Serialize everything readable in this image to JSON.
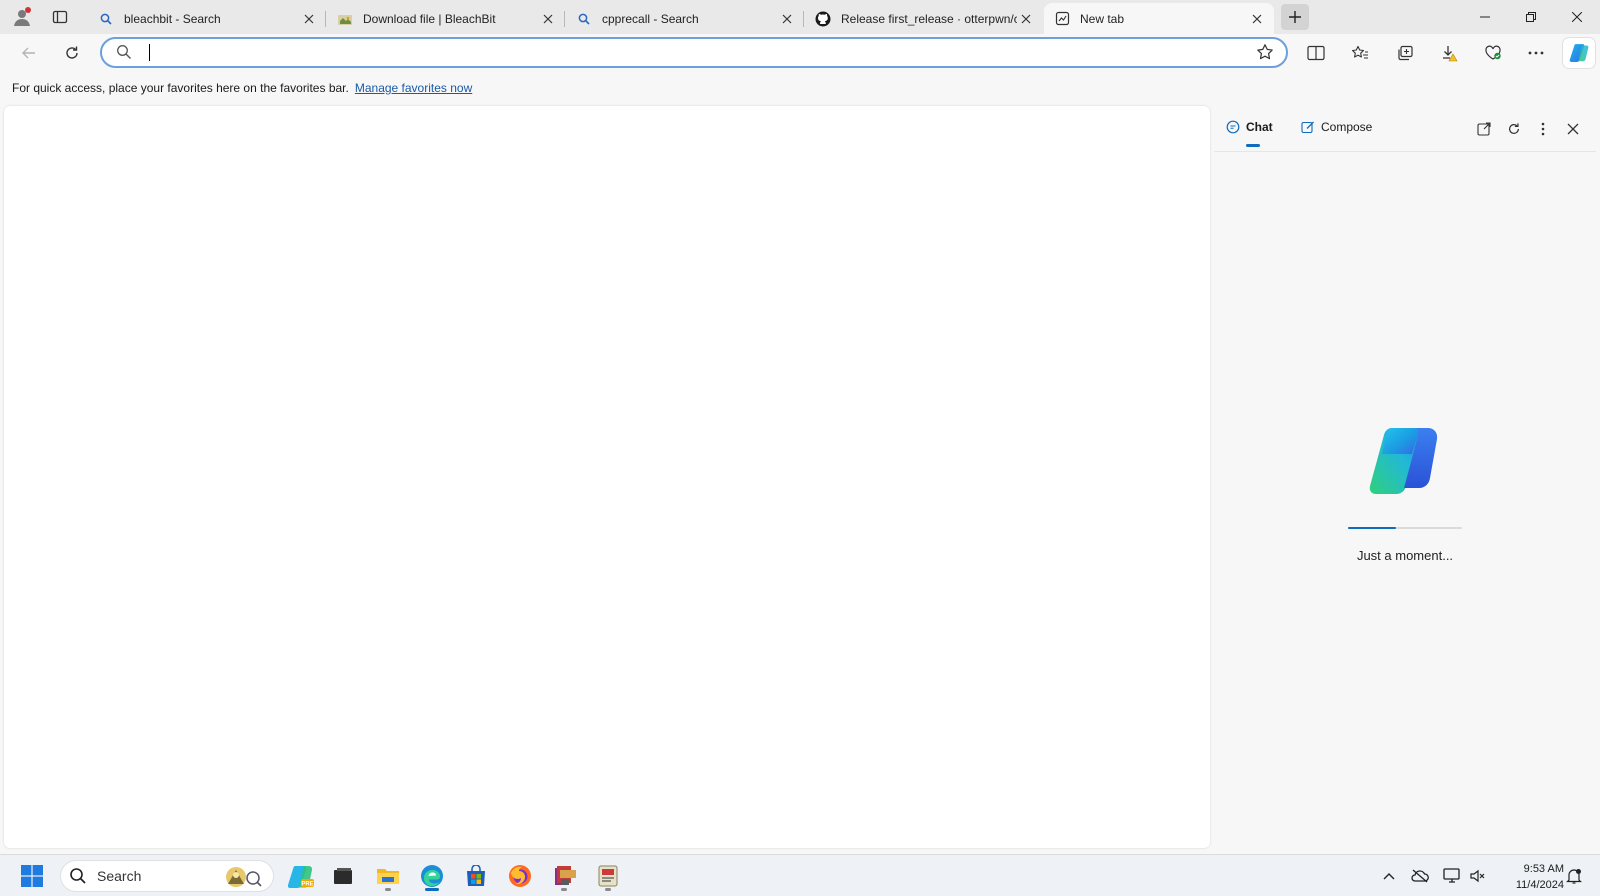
{
  "tabs": [
    {
      "title": "bleachbit - Search",
      "icon": "search-icon"
    },
    {
      "title": "Download file | BleachBit",
      "icon": "bleachbit-favicon"
    },
    {
      "title": "cpprecall - Search",
      "icon": "search-icon"
    },
    {
      "title": "Release first_release · otterpwn/cp",
      "icon": "github-icon"
    },
    {
      "title": "New tab",
      "icon": "new-tab-icon",
      "active": true
    }
  ],
  "address_bar": {
    "value": "",
    "placeholder": ""
  },
  "favorites_bar": {
    "message": "For quick access, place your favorites here on the favorites bar.",
    "link": "Manage favorites now"
  },
  "sidebar": {
    "tabs": [
      {
        "label": "Chat",
        "active": true
      },
      {
        "label": "Compose",
        "active": false
      }
    ],
    "loading_text": "Just a moment...",
    "progress": 0.42
  },
  "taskbar": {
    "search_label": "Search",
    "time": "9:53 AM",
    "date": "11/4/2024"
  },
  "colors": {
    "accent": "#0f6cbd",
    "omnibox_border": "#6c9fdc",
    "link": "#1a5aa8"
  }
}
